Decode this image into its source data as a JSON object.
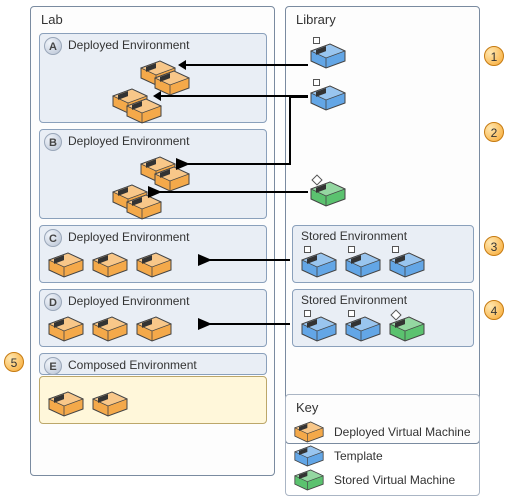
{
  "lab": {
    "title": "Lab",
    "environments": [
      {
        "badge": "A",
        "title": "Deployed Environment"
      },
      {
        "badge": "B",
        "title": "Deployed Environment"
      },
      {
        "badge": "C",
        "title": "Deployed Environment"
      },
      {
        "badge": "D",
        "title": "Deployed Environment"
      },
      {
        "badge": "E",
        "title": "Composed Environment"
      }
    ]
  },
  "library": {
    "title": "Library",
    "stored": [
      {
        "title": "Stored Environment"
      },
      {
        "title": "Stored Environment"
      }
    ]
  },
  "key": {
    "title": "Key",
    "rows": [
      "Deployed Virtual Machine",
      "Template",
      "Stored Virtual Machine"
    ]
  },
  "markers": [
    "1",
    "2",
    "3",
    "4",
    "5"
  ]
}
